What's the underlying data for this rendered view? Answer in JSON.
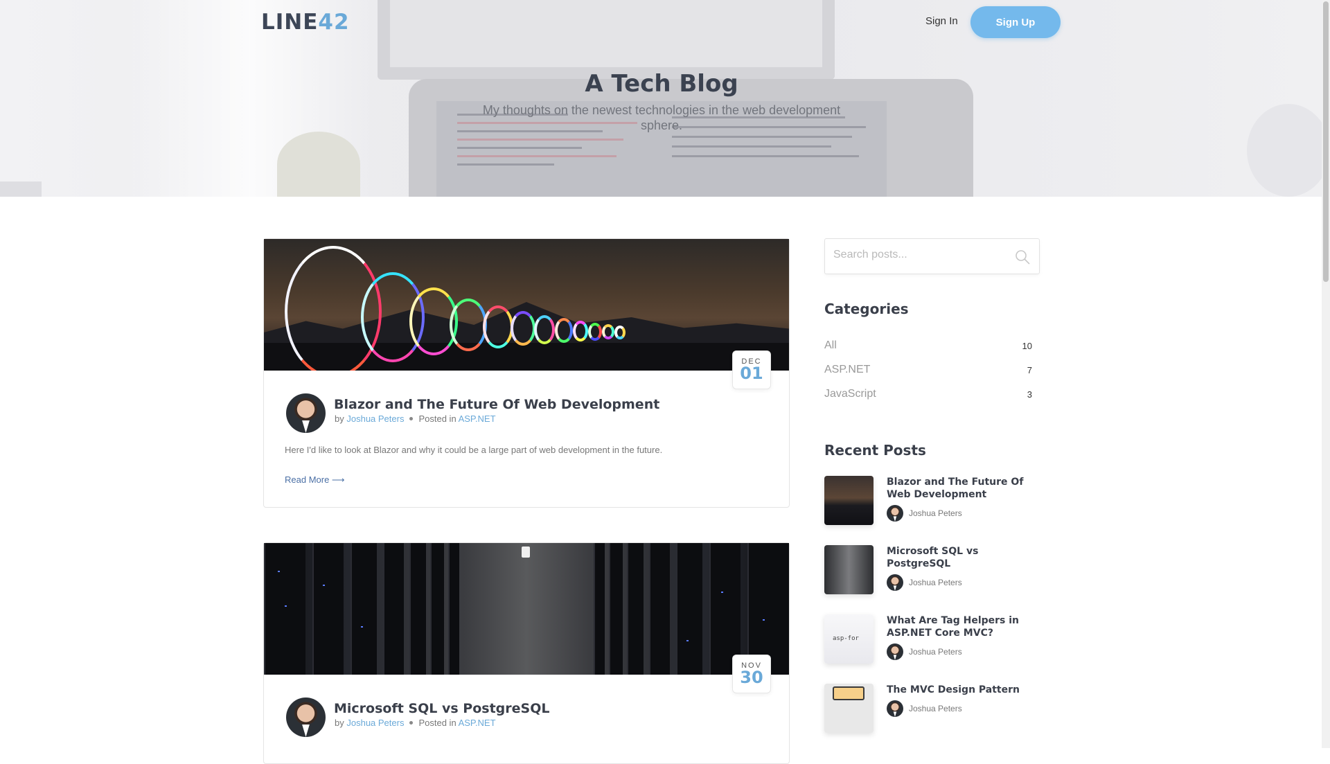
{
  "nav": {
    "logo_main": "LINE",
    "logo_accent": "42",
    "sign_in": "Sign In",
    "sign_up": "Sign Up"
  },
  "hero": {
    "title": "A Tech Blog",
    "subtitle": "My thoughts on the newest technologies in the web development sphere."
  },
  "posts": [
    {
      "month": "DEC",
      "day": "01",
      "title": "Blazor and The Future Of Web Development",
      "by": "by",
      "author": "Joshua Peters",
      "posted_in": "Posted in",
      "category": "ASP.NET",
      "excerpt": "Here I'd like to look at Blazor and why it could be a large part of web development in the future.",
      "read_more": "Read More ⟶"
    },
    {
      "month": "NOV",
      "day": "30",
      "title": "Microsoft SQL vs PostgreSQL",
      "by": "by",
      "author": "Joshua Peters",
      "posted_in": "Posted in",
      "category": "ASP.NET"
    }
  ],
  "sidebar": {
    "search_placeholder": "Search posts...",
    "categories_heading": "Categories",
    "categories": [
      {
        "label": "All",
        "count": "10"
      },
      {
        "label": "ASP.NET",
        "count": "7"
      },
      {
        "label": "JavaScript",
        "count": "3"
      }
    ],
    "recent_heading": "Recent Posts",
    "recent": [
      {
        "title": "Blazor and The Future Of Web Development",
        "author": "Joshua Peters"
      },
      {
        "title": "Microsoft SQL vs PostgreSQL",
        "author": "Joshua Peters"
      },
      {
        "title": "What Are Tag Helpers in ASP.NET Core MVC?",
        "author": "Joshua Peters",
        "thumb_text": "asp-for"
      },
      {
        "title": "The MVC Design Pattern",
        "author": "Joshua Peters"
      }
    ]
  },
  "colors": {
    "accent": "#6aa9d8",
    "sign_up_bg": "#74b9ec",
    "heading": "#3a3f4a",
    "link": "#4a6fa5"
  },
  "icons": [
    "search-icon",
    "arrow-right-icon"
  ]
}
